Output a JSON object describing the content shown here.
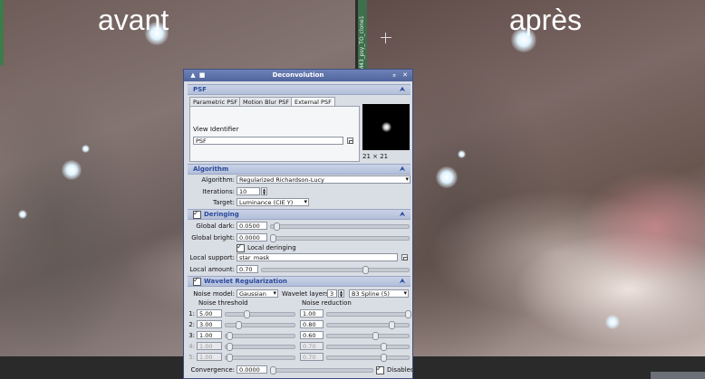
{
  "captions": {
    "before": "avant",
    "after": "après"
  },
  "right_panel_tab": "M43_psy_TO_clone1",
  "dialog": {
    "title": "Deconvolution",
    "psf": {
      "header": "PSF",
      "tabs": [
        "Parametric PSF",
        "Motion Blur PSF",
        "External PSF"
      ],
      "active_tab": "External PSF",
      "view_identifier_label": "View Identifier",
      "view_identifier_value": "PSF",
      "thumb_size": "21 × 21"
    },
    "algorithm": {
      "header": "Algorithm",
      "algorithm_label": "Algorithm:",
      "algorithm_value": "Regularized Richardson-Lucy",
      "iterations_label": "Iterations:",
      "iterations_value": "10",
      "target_label": "Target:",
      "target_value": "Luminance (CIE Y)"
    },
    "deringing": {
      "header": "Deringing",
      "enabled": true,
      "global_dark_label": "Global dark:",
      "global_dark_value": "0.0500",
      "global_bright_label": "Global bright:",
      "global_bright_value": "0.0000",
      "local_deringing_label": "Local deringing",
      "local_deringing_checked": true,
      "local_support_label": "Local support:",
      "local_support_value": "star_mask",
      "local_amount_label": "Local amount:",
      "local_amount_value": "0.70"
    },
    "wavelet": {
      "header": "Wavelet Regularization",
      "enabled": true,
      "noise_model_label": "Noise model:",
      "noise_model_value": "Gaussian",
      "wavelet_layers_label": "Wavelet layers:",
      "wavelet_layers_value": "3",
      "wavelet_type_value": "B3 Spline (5)",
      "noise_threshold_label": "Noise threshold",
      "noise_reduction_label": "Noise reduction",
      "layers": [
        {
          "n": "1:",
          "threshold": "5.00",
          "reduction": "1.00",
          "enabled": true
        },
        {
          "n": "2:",
          "threshold": "3.00",
          "reduction": "0.80",
          "enabled": true
        },
        {
          "n": "3:",
          "threshold": "1.00",
          "reduction": "0.60",
          "enabled": true
        },
        {
          "n": "4:",
          "threshold": "1.00",
          "reduction": "0.70",
          "enabled": false
        },
        {
          "n": "5:",
          "threshold": "1.00",
          "reduction": "0.70",
          "enabled": false
        }
      ],
      "convergence_label": "Convergence:",
      "convergence_value": "0.0000",
      "disabled_label": "Disabled",
      "disabled_checked": true
    }
  }
}
